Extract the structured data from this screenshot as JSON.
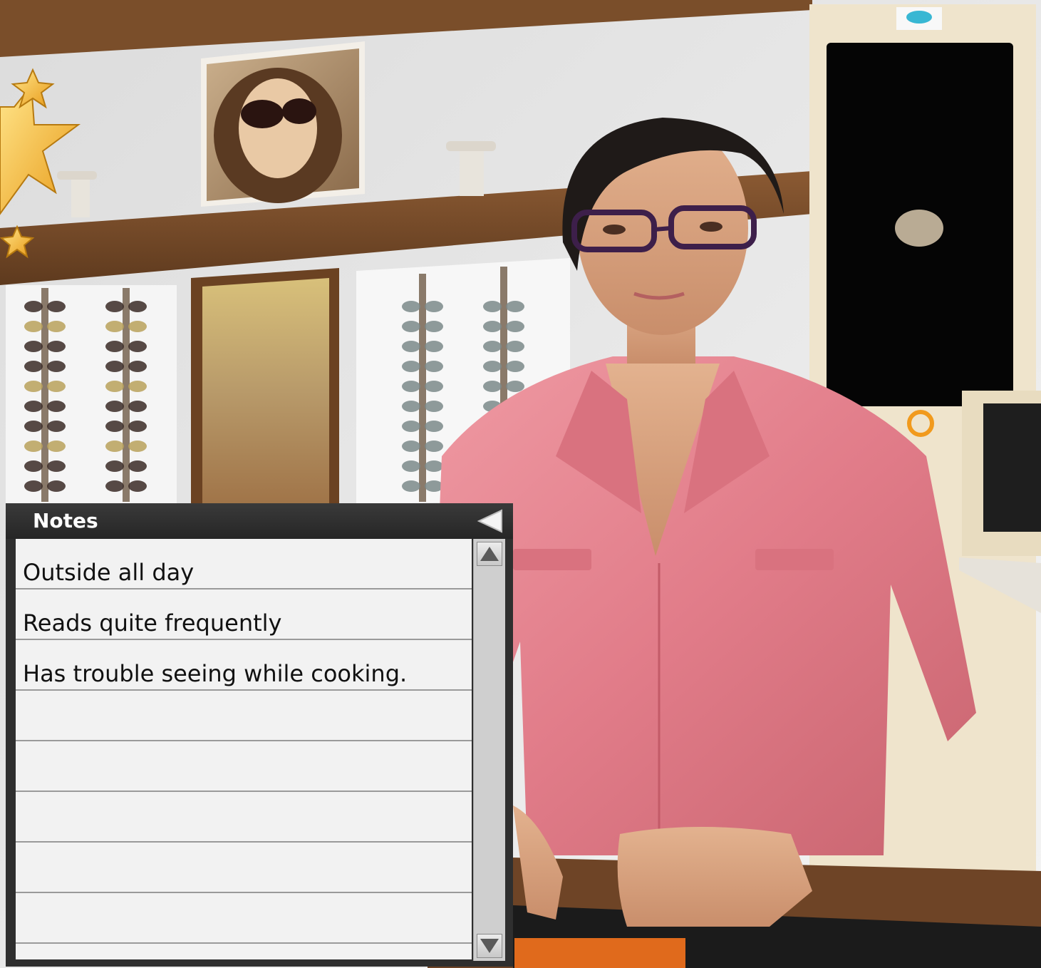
{
  "notes": {
    "title": "Notes",
    "items": [
      "Outside all day",
      "Reads quite frequently",
      "Has trouble seeing while cooking.",
      "",
      "",
      "",
      "",
      ""
    ]
  },
  "icons": {
    "collapse": "left-triangle-icon",
    "scroll_up": "up-triangle-icon",
    "scroll_down": "down-triangle-icon",
    "stars": "star-icon"
  },
  "colors": {
    "panel_dark": "#2f2f2f",
    "notes_bg": "#f2f2f2",
    "shirt_pink": "#e5828f",
    "shelf_brown": "#7a4e2a"
  }
}
